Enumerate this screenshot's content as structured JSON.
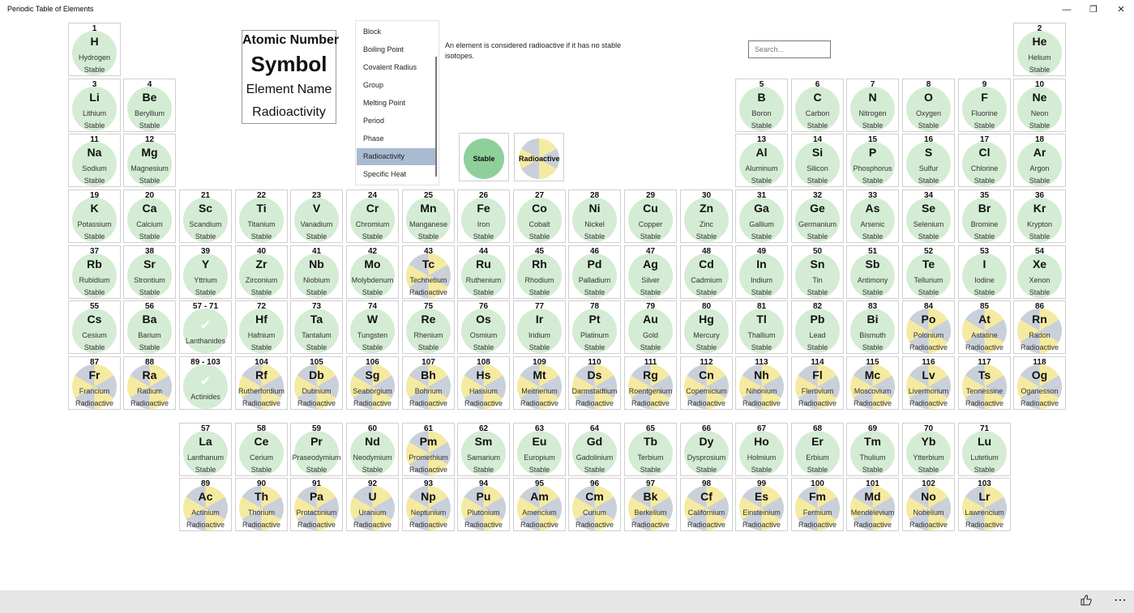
{
  "app": {
    "title": "Periodic Table of Elements",
    "window_buttons": {
      "minimize": "—",
      "maximize": "❐",
      "close": "✕"
    }
  },
  "legend": {
    "atomic_number": "Atomic Number",
    "symbol": "Symbol",
    "element_name": "Element Name",
    "radioactivity": "Radioactivity"
  },
  "properties": {
    "items": [
      "Block",
      "Boiling Point",
      "Covalent Radius",
      "Group",
      "Melting Point",
      "Period",
      "Phase",
      "Radioactivity",
      "Specific Heat"
    ],
    "selected": "Radioactivity"
  },
  "info_text": "An element is considered radioactive if it has no stable isotopes.",
  "legend_keys": {
    "stable": "Stable",
    "radioactive": "Radioactive"
  },
  "search": {
    "placeholder": "Search..."
  },
  "colors": {
    "stable": "#d4ecd4",
    "radioactive_yellow": "#f5eaa2",
    "radioactive_gray": "#c9d0d9",
    "selected_property": "#a9bbd1"
  },
  "bottom_bar": {
    "like_icon": "thumbs-up-icon",
    "more_icon": "more-icon"
  },
  "elements": [
    {
      "num": "1",
      "sym": "H",
      "name": "Hydrogen",
      "status": "Stable"
    },
    {
      "num": "2",
      "sym": "He",
      "name": "Helium",
      "status": "Stable"
    },
    {
      "num": "3",
      "sym": "Li",
      "name": "Lithium",
      "status": "Stable"
    },
    {
      "num": "4",
      "sym": "Be",
      "name": "Beryllium",
      "status": "Stable"
    },
    {
      "num": "5",
      "sym": "B",
      "name": "Boron",
      "status": "Stable"
    },
    {
      "num": "6",
      "sym": "C",
      "name": "Carbon",
      "status": "Stable"
    },
    {
      "num": "7",
      "sym": "N",
      "name": "Nitrogen",
      "status": "Stable"
    },
    {
      "num": "8",
      "sym": "O",
      "name": "Oxygen",
      "status": "Stable"
    },
    {
      "num": "9",
      "sym": "F",
      "name": "Fluorine",
      "status": "Stable"
    },
    {
      "num": "10",
      "sym": "Ne",
      "name": "Neon",
      "status": "Stable"
    },
    {
      "num": "11",
      "sym": "Na",
      "name": "Sodium",
      "status": "Stable"
    },
    {
      "num": "12",
      "sym": "Mg",
      "name": "Magnesium",
      "status": "Stable"
    },
    {
      "num": "13",
      "sym": "Al",
      "name": "Aluminum",
      "status": "Stable"
    },
    {
      "num": "14",
      "sym": "Si",
      "name": "Silicon",
      "status": "Stable"
    },
    {
      "num": "15",
      "sym": "P",
      "name": "Phosphorus",
      "status": "Stable"
    },
    {
      "num": "16",
      "sym": "S",
      "name": "Sulfur",
      "status": "Stable"
    },
    {
      "num": "17",
      "sym": "Cl",
      "name": "Chlorine",
      "status": "Stable"
    },
    {
      "num": "18",
      "sym": "Ar",
      "name": "Argon",
      "status": "Stable"
    },
    {
      "num": "19",
      "sym": "K",
      "name": "Potassium",
      "status": "Stable"
    },
    {
      "num": "20",
      "sym": "Ca",
      "name": "Calcium",
      "status": "Stable"
    },
    {
      "num": "21",
      "sym": "Sc",
      "name": "Scandium",
      "status": "Stable"
    },
    {
      "num": "22",
      "sym": "Ti",
      "name": "Titanium",
      "status": "Stable"
    },
    {
      "num": "23",
      "sym": "V",
      "name": "Vanadium",
      "status": "Stable"
    },
    {
      "num": "24",
      "sym": "Cr",
      "name": "Chromium",
      "status": "Stable"
    },
    {
      "num": "25",
      "sym": "Mn",
      "name": "Manganese",
      "status": "Stable"
    },
    {
      "num": "26",
      "sym": "Fe",
      "name": "Iron",
      "status": "Stable"
    },
    {
      "num": "27",
      "sym": "Co",
      "name": "Cobalt",
      "status": "Stable"
    },
    {
      "num": "28",
      "sym": "Ni",
      "name": "Nickel",
      "status": "Stable"
    },
    {
      "num": "29",
      "sym": "Cu",
      "name": "Copper",
      "status": "Stable"
    },
    {
      "num": "30",
      "sym": "Zn",
      "name": "Zinc",
      "status": "Stable"
    },
    {
      "num": "31",
      "sym": "Ga",
      "name": "Gallium",
      "status": "Stable"
    },
    {
      "num": "32",
      "sym": "Ge",
      "name": "Germanium",
      "status": "Stable"
    },
    {
      "num": "33",
      "sym": "As",
      "name": "Arsenic",
      "status": "Stable"
    },
    {
      "num": "34",
      "sym": "Se",
      "name": "Selenium",
      "status": "Stable"
    },
    {
      "num": "35",
      "sym": "Br",
      "name": "Bromine",
      "status": "Stable"
    },
    {
      "num": "36",
      "sym": "Kr",
      "name": "Krypton",
      "status": "Stable"
    },
    {
      "num": "37",
      "sym": "Rb",
      "name": "Rubidium",
      "status": "Stable"
    },
    {
      "num": "38",
      "sym": "Sr",
      "name": "Strontium",
      "status": "Stable"
    },
    {
      "num": "39",
      "sym": "Y",
      "name": "Yttrium",
      "status": "Stable"
    },
    {
      "num": "40",
      "sym": "Zr",
      "name": "Zirconium",
      "status": "Stable"
    },
    {
      "num": "41",
      "sym": "Nb",
      "name": "Niobium",
      "status": "Stable"
    },
    {
      "num": "42",
      "sym": "Mo",
      "name": "Molybdenum",
      "status": "Stable"
    },
    {
      "num": "43",
      "sym": "Tc",
      "name": "Technetium",
      "status": "Radioactive"
    },
    {
      "num": "44",
      "sym": "Ru",
      "name": "Ruthenium",
      "status": "Stable"
    },
    {
      "num": "45",
      "sym": "Rh",
      "name": "Rhodium",
      "status": "Stable"
    },
    {
      "num": "46",
      "sym": "Pd",
      "name": "Palladium",
      "status": "Stable"
    },
    {
      "num": "47",
      "sym": "Ag",
      "name": "Silver",
      "status": "Stable"
    },
    {
      "num": "48",
      "sym": "Cd",
      "name": "Cadmium",
      "status": "Stable"
    },
    {
      "num": "49",
      "sym": "In",
      "name": "Indium",
      "status": "Stable"
    },
    {
      "num": "50",
      "sym": "Sn",
      "name": "Tin",
      "status": "Stable"
    },
    {
      "num": "51",
      "sym": "Sb",
      "name": "Antimony",
      "status": "Stable"
    },
    {
      "num": "52",
      "sym": "Te",
      "name": "Tellurium",
      "status": "Stable"
    },
    {
      "num": "53",
      "sym": "I",
      "name": "Iodine",
      "status": "Stable"
    },
    {
      "num": "54",
      "sym": "Xe",
      "name": "Xenon",
      "status": "Stable"
    },
    {
      "num": "55",
      "sym": "Cs",
      "name": "Cesium",
      "status": "Stable"
    },
    {
      "num": "56",
      "sym": "Ba",
      "name": "Barium",
      "status": "Stable"
    },
    {
      "num": "57 - 71",
      "sym": "",
      "name": "Lanthanides",
      "status": "",
      "range": true
    },
    {
      "num": "72",
      "sym": "Hf",
      "name": "Hafnium",
      "status": "Stable"
    },
    {
      "num": "73",
      "sym": "Ta",
      "name": "Tantalum",
      "status": "Stable"
    },
    {
      "num": "74",
      "sym": "W",
      "name": "Tungsten",
      "status": "Stable"
    },
    {
      "num": "75",
      "sym": "Re",
      "name": "Rhenium",
      "status": "Stable"
    },
    {
      "num": "76",
      "sym": "Os",
      "name": "Osmium",
      "status": "Stable"
    },
    {
      "num": "77",
      "sym": "Ir",
      "name": "Iridium",
      "status": "Stable"
    },
    {
      "num": "78",
      "sym": "Pt",
      "name": "Platinum",
      "status": "Stable"
    },
    {
      "num": "79",
      "sym": "Au",
      "name": "Gold",
      "status": "Stable"
    },
    {
      "num": "80",
      "sym": "Hg",
      "name": "Mercury",
      "status": "Stable"
    },
    {
      "num": "81",
      "sym": "Tl",
      "name": "Thallium",
      "status": "Stable"
    },
    {
      "num": "82",
      "sym": "Pb",
      "name": "Lead",
      "status": "Stable"
    },
    {
      "num": "83",
      "sym": "Bi",
      "name": "Bismuth",
      "status": "Stable"
    },
    {
      "num": "84",
      "sym": "Po",
      "name": "Polonium",
      "status": "Radioactive"
    },
    {
      "num": "85",
      "sym": "At",
      "name": "Astatine",
      "status": "Radioactive"
    },
    {
      "num": "86",
      "sym": "Rn",
      "name": "Radon",
      "status": "Radioactive"
    },
    {
      "num": "87",
      "sym": "Fr",
      "name": "Francium",
      "status": "Radioactive"
    },
    {
      "num": "88",
      "sym": "Ra",
      "name": "Radium",
      "status": "Radioactive"
    },
    {
      "num": "89 - 103",
      "sym": "",
      "name": "Actinides",
      "status": "",
      "range": true
    },
    {
      "num": "104",
      "sym": "Rf",
      "name": "Rutherfordium",
      "status": "Radioactive"
    },
    {
      "num": "105",
      "sym": "Db",
      "name": "Dubnium",
      "status": "Radioactive"
    },
    {
      "num": "106",
      "sym": "Sg",
      "name": "Seaborgium",
      "status": "Radioactive"
    },
    {
      "num": "107",
      "sym": "Bh",
      "name": "Bohrium",
      "status": "Radioactive"
    },
    {
      "num": "108",
      "sym": "Hs",
      "name": "Hassium",
      "status": "Radioactive"
    },
    {
      "num": "109",
      "sym": "Mt",
      "name": "Meitnerium",
      "status": "Radioactive"
    },
    {
      "num": "110",
      "sym": "Ds",
      "name": "Darmstadtium",
      "status": "Radioactive"
    },
    {
      "num": "111",
      "sym": "Rg",
      "name": "Roentgenium",
      "status": "Radioactive"
    },
    {
      "num": "112",
      "sym": "Cn",
      "name": "Copernicium",
      "status": "Radioactive"
    },
    {
      "num": "113",
      "sym": "Nh",
      "name": "Nihonium",
      "status": "Radioactive"
    },
    {
      "num": "114",
      "sym": "Fl",
      "name": "Flerovium",
      "status": "Radioactive"
    },
    {
      "num": "115",
      "sym": "Mc",
      "name": "Moscovium",
      "status": "Radioactive"
    },
    {
      "num": "116",
      "sym": "Lv",
      "name": "Livermorium",
      "status": "Radioactive"
    },
    {
      "num": "117",
      "sym": "Ts",
      "name": "Tennessine",
      "status": "Radioactive"
    },
    {
      "num": "118",
      "sym": "Og",
      "name": "Oganesson",
      "status": "Radioactive"
    },
    {
      "num": "57",
      "sym": "La",
      "name": "Lanthanum",
      "status": "Stable"
    },
    {
      "num": "58",
      "sym": "Ce",
      "name": "Cerium",
      "status": "Stable"
    },
    {
      "num": "59",
      "sym": "Pr",
      "name": "Praseodymium",
      "status": "Stable"
    },
    {
      "num": "60",
      "sym": "Nd",
      "name": "Neodymium",
      "status": "Stable"
    },
    {
      "num": "61",
      "sym": "Pm",
      "name": "Promethium",
      "status": "Radioactive"
    },
    {
      "num": "62",
      "sym": "Sm",
      "name": "Samarium",
      "status": "Stable"
    },
    {
      "num": "63",
      "sym": "Eu",
      "name": "Europium",
      "status": "Stable"
    },
    {
      "num": "64",
      "sym": "Gd",
      "name": "Gadolinium",
      "status": "Stable"
    },
    {
      "num": "65",
      "sym": "Tb",
      "name": "Terbium",
      "status": "Stable"
    },
    {
      "num": "66",
      "sym": "Dy",
      "name": "Dysprosium",
      "status": "Stable"
    },
    {
      "num": "67",
      "sym": "Ho",
      "name": "Holmium",
      "status": "Stable"
    },
    {
      "num": "68",
      "sym": "Er",
      "name": "Erbium",
      "status": "Stable"
    },
    {
      "num": "69",
      "sym": "Tm",
      "name": "Thulium",
      "status": "Stable"
    },
    {
      "num": "70",
      "sym": "Yb",
      "name": "Ytterbium",
      "status": "Stable"
    },
    {
      "num": "71",
      "sym": "Lu",
      "name": "Lutetium",
      "status": "Stable"
    },
    {
      "num": "89",
      "sym": "Ac",
      "name": "Actinium",
      "status": "Radioactive"
    },
    {
      "num": "90",
      "sym": "Th",
      "name": "Thorium",
      "status": "Radioactive"
    },
    {
      "num": "91",
      "sym": "Pa",
      "name": "Protactinium",
      "status": "Radioactive"
    },
    {
      "num": "92",
      "sym": "U",
      "name": "Uranium",
      "status": "Radioactive"
    },
    {
      "num": "93",
      "sym": "Np",
      "name": "Neptunium",
      "status": "Radioactive"
    },
    {
      "num": "94",
      "sym": "Pu",
      "name": "Plutonium",
      "status": "Radioactive"
    },
    {
      "num": "95",
      "sym": "Am",
      "name": "Americium",
      "status": "Radioactive"
    },
    {
      "num": "96",
      "sym": "Cm",
      "name": "Curium",
      "status": "Radioactive"
    },
    {
      "num": "97",
      "sym": "Bk",
      "name": "Berkelium",
      "status": "Radioactive"
    },
    {
      "num": "98",
      "sym": "Cf",
      "name": "Californium",
      "status": "Radioactive"
    },
    {
      "num": "99",
      "sym": "Es",
      "name": "Einsteinium",
      "status": "Radioactive"
    },
    {
      "num": "100",
      "sym": "Fm",
      "name": "Fermium",
      "status": "Radioactive"
    },
    {
      "num": "101",
      "sym": "Md",
      "name": "Mendelevium",
      "status": "Radioactive"
    },
    {
      "num": "102",
      "sym": "No",
      "name": "Nobelium",
      "status": "Radioactive"
    },
    {
      "num": "103",
      "sym": "Lr",
      "name": "Lawrencium",
      "status": "Radioactive"
    }
  ]
}
